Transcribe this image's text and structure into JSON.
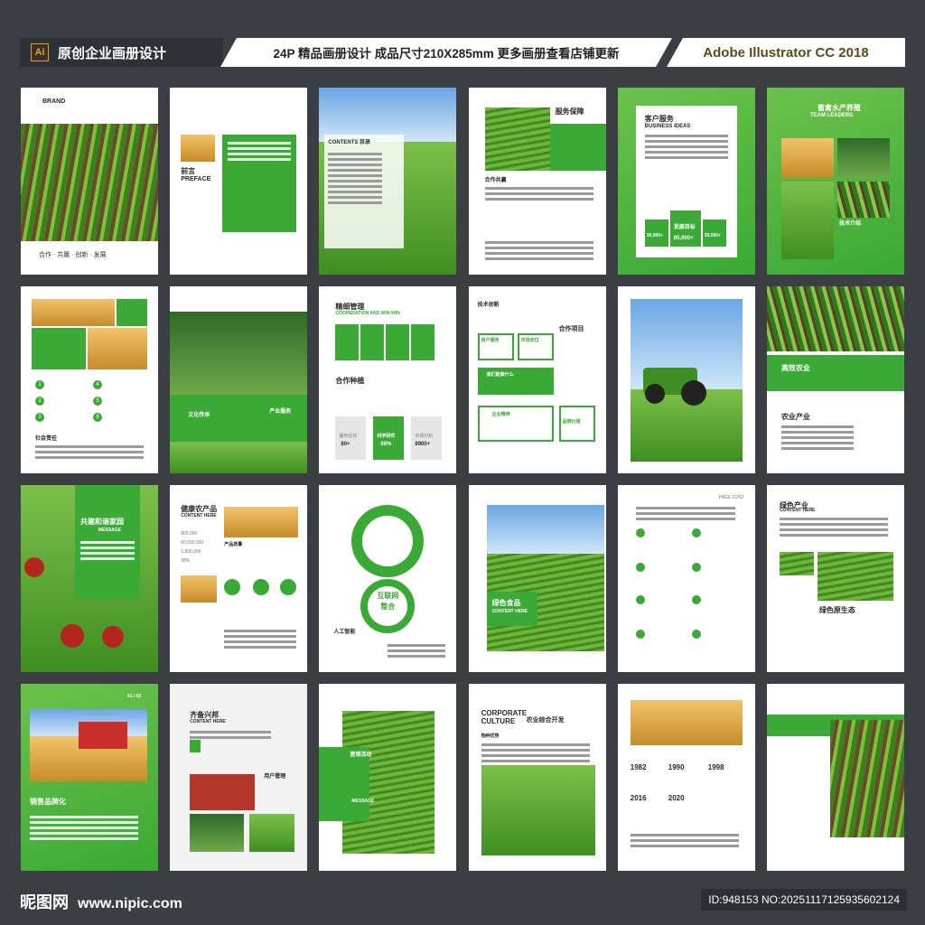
{
  "banner": {
    "ai_label": "Ai",
    "left_title": "原创企业画册设计",
    "center_text": "24P 精品画册设计 成品尺寸210X285mm 更多画册查看店铺更新",
    "right_text": "Adobe Illustrator CC 2018"
  },
  "pages": {
    "p1": {
      "brand": "BRAND",
      "slogan": "合作 · 共赢 · 创新 · 发展"
    },
    "p2": {
      "title": "前言",
      "subtitle": "PREFACE"
    },
    "p3": {
      "title": "CONTENTS 目录"
    },
    "p4": {
      "title": "服务保障",
      "sub": "合作共赢"
    },
    "p5": {
      "title": "客户服务",
      "subtitle": "BUSINESS IDEAS",
      "stat1": "30,000+",
      "stat_mid": "发展目标",
      "stat2": "85,000+",
      "stat3": "30,000+"
    },
    "p6": {
      "title": "畜禽水产养殖",
      "subtitle": "TEAM LEADERS",
      "label": "技术介绍"
    },
    "p7": {
      "tag": "社会责任"
    },
    "p8": {
      "label1": "文化传承",
      "label2": "产业服务"
    },
    "p9": {
      "title": "精细管理",
      "subtitle": "COOPERATION AND WIN-WIN",
      "title2": "合作种植",
      "s1": "80+",
      "s2": "98%",
      "s3": "8900+",
      "l1": "服务近年",
      "l2": "科学研究",
      "l3": "市场分析"
    },
    "p10": {
      "title": "技术创新",
      "title2": "合作项目",
      "b1": "用户服务",
      "b2": "市场定位",
      "b3": "我们能做什么",
      "b4": "企业精神",
      "b5": "品牌价值"
    },
    "p12": {
      "label": "高效农业",
      "label2": "农业产业"
    },
    "p13": {
      "title": "共建和谐家园",
      "sub": "MESSAGE"
    },
    "p14": {
      "title": "健康农产品",
      "subtitle": "CONTENT HERE",
      "label": "产品质量",
      "s1": "800,000",
      "s2": "60,000,000",
      "s3": "5,800,000",
      "s4": "98%"
    },
    "p15": {
      "center": "互联网",
      "center2": "整合",
      "label": "人工智能"
    },
    "p16": {
      "title": "绿色食品",
      "subtitle": "CONTENT HERE"
    },
    "p17": {
      "page": "PAGE 01/02"
    },
    "p18": {
      "title": "绿色产业",
      "subtitle": "CONTENT HERE",
      "label": "绿色原生态"
    },
    "p19": {
      "title": "销售品牌化",
      "page": "01 / 02"
    },
    "p20": {
      "title": "齐备兴邦",
      "subtitle": "CONTENT HERE",
      "label": "用户管理"
    },
    "p21": {
      "label": "营销活动",
      "sub": "MESSAGE"
    },
    "p22": {
      "title": "CORPORATE",
      "title2": "CULTURE",
      "title3": "农业综合开发",
      "label": "物种优势"
    },
    "p23": {
      "y1": "1982",
      "y2": "1990",
      "y3": "1998",
      "y4": "2016",
      "y5": "2020"
    }
  },
  "footer": {
    "logo_cn": "昵图网",
    "logo_url": "www.nipic.com",
    "image_id": "ID:948153 NO:20251117125935602124"
  }
}
